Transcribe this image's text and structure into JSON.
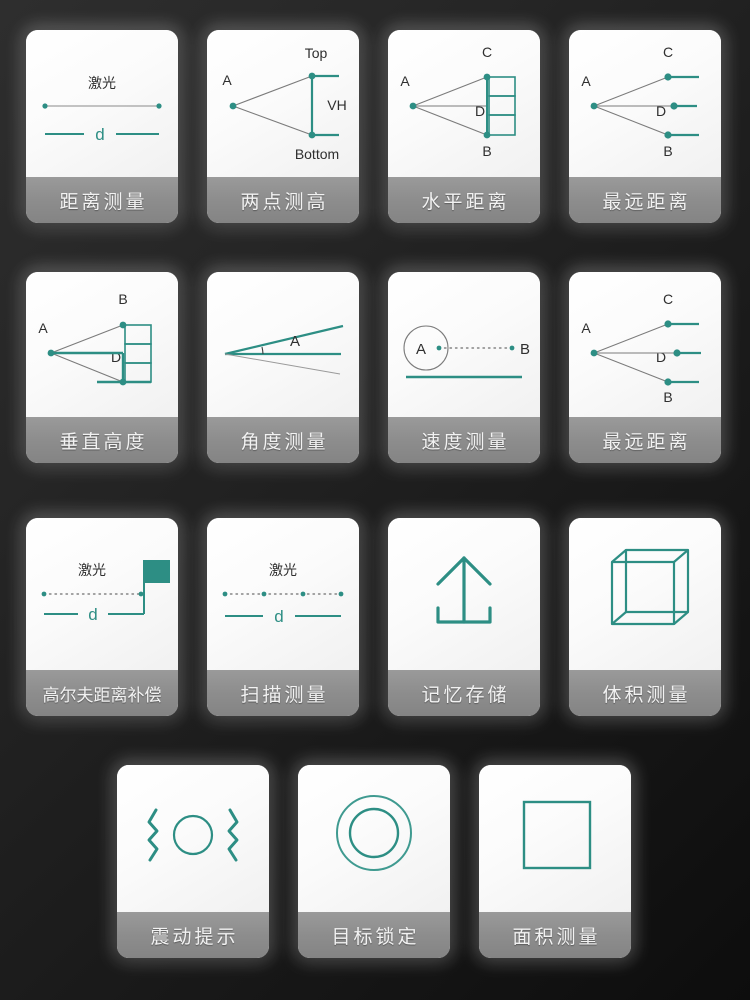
{
  "theme": {
    "accent_teal": "#2d8e84",
    "label_band": "#8d8d8d",
    "card_face": "#ffffff",
    "background_dark": "#1a1a1a",
    "geometry_line": "#6b6b6b",
    "geometry_text": "#2f2f2f"
  },
  "grid": {
    "rows": 4,
    "columns": [
      4,
      4,
      4,
      3
    ],
    "total_cards": 15
  },
  "cards": [
    {
      "id": "distance-measurement",
      "label": "距离测量",
      "icon": "laser-distance-line",
      "annotations": {
        "laser": "激光",
        "d": "d"
      }
    },
    {
      "id": "two-point-height",
      "label": "两点测高",
      "icon": "two-point-height-triangle",
      "annotations": {
        "a": "A",
        "top": "Top",
        "bottom": "Bottom",
        "vh": "VH"
      }
    },
    {
      "id": "horizontal-distance",
      "label": "水平距离",
      "icon": "horizontal-distance-wall",
      "annotations": {
        "a": "A",
        "b": "B",
        "c": "C",
        "d": "D"
      }
    },
    {
      "id": "farthest-distance-1",
      "label": "最远距离",
      "icon": "farthest-distance-fan",
      "annotations": {
        "a": "A",
        "b": "B",
        "c": "C",
        "d": "D"
      }
    },
    {
      "id": "vertical-height",
      "label": "垂直高度",
      "icon": "vertical-height-wall",
      "annotations": {
        "a": "A",
        "b": "B",
        "d": "D"
      }
    },
    {
      "id": "angle-measurement",
      "label": "角度测量",
      "icon": "angle-wedge",
      "annotations": {
        "a": "A"
      }
    },
    {
      "id": "speed-measurement",
      "label": "速度测量",
      "icon": "speed-circle-dotted",
      "annotations": {
        "a": "A",
        "b": "B"
      }
    },
    {
      "id": "farthest-distance-2",
      "label": "最远距离",
      "icon": "farthest-distance-fan",
      "annotations": {
        "a": "A",
        "b": "B",
        "c": "C",
        "d": "D"
      }
    },
    {
      "id": "golf-distance-compensation",
      "label": "高尔夫距离补偿",
      "icon": "golf-flag-laser",
      "annotations": {
        "laser": "激光",
        "d": "d"
      }
    },
    {
      "id": "scan-measurement",
      "label": "扫描测量",
      "icon": "scan-dotted-laser",
      "annotations": {
        "laser": "激光",
        "d": "d"
      }
    },
    {
      "id": "memory-storage",
      "label": "记忆存储",
      "icon": "upload-arrow-icon",
      "annotations": {}
    },
    {
      "id": "volume-measurement",
      "label": "体积测量",
      "icon": "wireframe-cube-icon",
      "annotations": {}
    },
    {
      "id": "vibration-alert",
      "label": "震动提示",
      "icon": "vibration-icon",
      "annotations": {}
    },
    {
      "id": "target-lock",
      "label": "目标锁定",
      "icon": "target-lock-rings-icon",
      "annotations": {}
    },
    {
      "id": "area-measurement",
      "label": "面积测量",
      "icon": "square-outline-icon",
      "annotations": {}
    }
  ]
}
